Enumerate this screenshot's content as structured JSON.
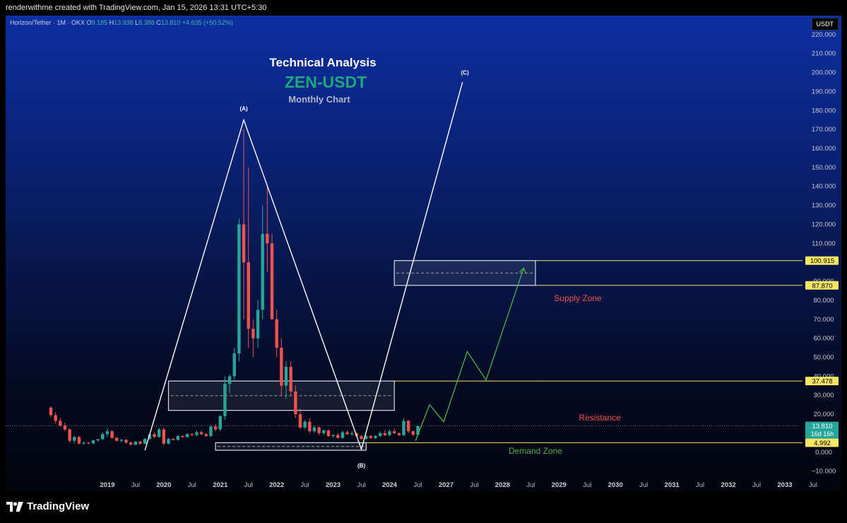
{
  "header": {
    "attribution": "renderwithme created with TradingView.com, Jan 15, 2026 13:31 UTC+5:30"
  },
  "legend": {
    "symbol": "Horizon/Tether · 1M · OKX",
    "open_label": "O",
    "open": "9.185",
    "high_label": "H",
    "high": "13.938",
    "low_label": "L",
    "low": "8.388",
    "close_label": "C",
    "close": "13.810",
    "change": "+4.635 (+50.52%)"
  },
  "currency_button": "USDT",
  "titles": {
    "title": "Technical Analysis",
    "pair": "ZEN-USDT",
    "subtitle": "Monthly Chart",
    "title_color": "#ffffff",
    "pair_color": "#1fa77c",
    "subtitle_color": "#aeb6c8"
  },
  "wave_labels": [
    "(A)",
    "(B)",
    "(C)"
  ],
  "zone_labels": {
    "supply": "Supply Zone",
    "resistance": "Resistance",
    "demand": "Demand Zone"
  },
  "colors": {
    "up": "#26a69a",
    "down": "#ef5350",
    "projection": "#4caf50",
    "level_line": "#f5e663",
    "supply_label": "#ef5350",
    "resistance_label": "#ef5350",
    "demand_label": "#4caf50",
    "price_badge": "#26a69a"
  },
  "chart_data": {
    "type": "candlestick",
    "symbol": "ZEN-USDT",
    "timeframe": "1M",
    "y_axis": {
      "ticks": [
        -10,
        0,
        10,
        20,
        30,
        40,
        50,
        60,
        70,
        80,
        90,
        100,
        110,
        120,
        130,
        140,
        150,
        160,
        170,
        180,
        190,
        200,
        210,
        220
      ],
      "tick_labels": [
        "−10.000",
        "0.000",
        "10.000",
        "20.000",
        "30.000",
        "40.000",
        "50.000",
        "60.000",
        "70.000",
        "80.000",
        "90.000",
        "100.000",
        "110.000",
        "120.000",
        "130.000",
        "140.000",
        "150.000",
        "160.000",
        "170.000",
        "180.000",
        "190.000",
        "200.000",
        "210.000",
        "220.000"
      ],
      "range": [
        -12,
        230
      ]
    },
    "x_axis": {
      "labels": [
        {
          "label": "2019",
          "m": 12,
          "bold": true
        },
        {
          "label": "Jul",
          "m": 18,
          "bold": false
        },
        {
          "label": "2020",
          "m": 24,
          "bold": true
        },
        {
          "label": "Jul",
          "m": 30,
          "bold": false
        },
        {
          "label": "2021",
          "m": 36,
          "bold": true
        },
        {
          "label": "Jul",
          "m": 42,
          "bold": false
        },
        {
          "label": "2022",
          "m": 48,
          "bold": true
        },
        {
          "label": "Jul",
          "m": 54,
          "bold": false
        },
        {
          "label": "2023",
          "m": 60,
          "bold": true
        },
        {
          "label": "Jul",
          "m": 66,
          "bold": false
        },
        {
          "label": "2024",
          "m": 72,
          "bold": true
        },
        {
          "label": "Jul",
          "m": 78,
          "bold": false
        },
        {
          "label": "2027",
          "m": 84,
          "bold": true
        },
        {
          "label": "Jul",
          "m": 90,
          "bold": false
        },
        {
          "label": "2028",
          "m": 96,
          "bold": true
        },
        {
          "label": "Jul",
          "m": 102,
          "bold": false
        },
        {
          "label": "2029",
          "m": 108,
          "bold": true
        },
        {
          "label": "Jul",
          "m": 114,
          "bold": false
        },
        {
          "label": "2030",
          "m": 120,
          "bold": true
        },
        {
          "label": "Jul",
          "m": 126,
          "bold": false
        },
        {
          "label": "2031",
          "m": 132,
          "bold": true
        },
        {
          "label": "Jul",
          "m": 138,
          "bold": false
        },
        {
          "label": "2032",
          "m": 144,
          "bold": true
        },
        {
          "label": "Jul",
          "m": 150,
          "bold": false
        },
        {
          "label": "2033",
          "m": 156,
          "bold": true
        },
        {
          "label": "Jul",
          "m": 162,
          "bold": false
        }
      ],
      "range": [
        0,
        168
      ]
    },
    "candles": [
      [
        23.5,
        24.0,
        18.5,
        19.5
      ],
      [
        19.5,
        21.0,
        15.0,
        16.5
      ],
      [
        16.5,
        18.0,
        13.5,
        14.0
      ],
      [
        14.0,
        15.5,
        11.0,
        12.0
      ],
      [
        12.0,
        12.5,
        5.0,
        6.0
      ],
      [
        6.0,
        8.5,
        4.5,
        8.0
      ],
      [
        8.0,
        8.5,
        4.0,
        4.5
      ],
      [
        4.5,
        5.5,
        4.0,
        5.0
      ],
      [
        5.0,
        5.5,
        4.2,
        4.6
      ],
      [
        4.6,
        6.5,
        4.0,
        6.2
      ],
      [
        6.2,
        7.0,
        5.5,
        6.8
      ],
      [
        6.8,
        10.5,
        6.5,
        9.5
      ],
      [
        9.5,
        12.5,
        8.0,
        11.0
      ],
      [
        11.0,
        11.5,
        7.0,
        7.5
      ],
      [
        7.5,
        8.0,
        5.5,
        6.0
      ],
      [
        6.0,
        7.0,
        5.0,
        6.5
      ],
      [
        6.5,
        7.0,
        4.5,
        5.0
      ],
      [
        5.0,
        5.5,
        3.5,
        4.0
      ],
      [
        4.0,
        6.0,
        3.5,
        5.5
      ],
      [
        5.5,
        6.0,
        4.0,
        4.5
      ],
      [
        4.5,
        7.5,
        4.0,
        7.0
      ],
      [
        7.0,
        10.0,
        6.5,
        9.5
      ],
      [
        9.5,
        10.5,
        7.5,
        8.0
      ],
      [
        8.0,
        13.0,
        7.5,
        12.0
      ],
      [
        12.0,
        13.0,
        3.5,
        4.5
      ],
      [
        4.5,
        7.5,
        4.0,
        7.0
      ],
      [
        7.0,
        7.5,
        6.0,
        6.5
      ],
      [
        6.5,
        9.0,
        6.0,
        8.5
      ],
      [
        8.5,
        9.0,
        7.5,
        8.0
      ],
      [
        8.0,
        10.0,
        7.5,
        9.5
      ],
      [
        9.5,
        10.0,
        8.5,
        9.0
      ],
      [
        9.0,
        11.5,
        8.5,
        10.5
      ],
      [
        10.5,
        11.5,
        9.0,
        9.5
      ],
      [
        9.5,
        10.0,
        8.0,
        8.5
      ],
      [
        8.5,
        14.0,
        8.0,
        13.5
      ],
      [
        13.5,
        15.0,
        11.0,
        12.0
      ],
      [
        12.0,
        19.5,
        11.0,
        19.0
      ],
      [
        19.0,
        40.0,
        17.0,
        36.0
      ],
      [
        36.0,
        41.0,
        31.0,
        40.0
      ],
      [
        40.0,
        55.0,
        38.0,
        52.0
      ],
      [
        52.0,
        123.0,
        48.0,
        120.0
      ],
      [
        120.0,
        170.0,
        70.0,
        100.0
      ],
      [
        100.0,
        150.0,
        55.0,
        65.0
      ],
      [
        65.0,
        70.0,
        50.0,
        60.0
      ],
      [
        60.0,
        80.0,
        55.0,
        75.0
      ],
      [
        75.0,
        130.0,
        70.0,
        115.0
      ],
      [
        115.0,
        140.0,
        95.0,
        110.0
      ],
      [
        110.0,
        115.0,
        80.0,
        70.0
      ],
      [
        70.0,
        75.0,
        50.0,
        55.0
      ],
      [
        55.0,
        60.0,
        30.0,
        35.0
      ],
      [
        35.0,
        48.0,
        28.0,
        45.0
      ],
      [
        45.0,
        48.0,
        30.0,
        32.0
      ],
      [
        32.0,
        35.0,
        18.0,
        20.0
      ],
      [
        20.0,
        23.0,
        12.0,
        13.0
      ],
      [
        13.0,
        17.0,
        12.0,
        16.0
      ],
      [
        16.0,
        18.0,
        10.0,
        11.0
      ],
      [
        11.0,
        14.0,
        10.0,
        13.0
      ],
      [
        13.0,
        13.5,
        9.0,
        10.0
      ],
      [
        10.0,
        12.0,
        9.0,
        11.5
      ],
      [
        11.5,
        12.0,
        8.0,
        8.5
      ],
      [
        8.5,
        9.5,
        7.5,
        9.0
      ],
      [
        9.0,
        10.0,
        7.0,
        7.5
      ],
      [
        7.5,
        11.5,
        7.0,
        10.5
      ],
      [
        10.5,
        11.5,
        9.0,
        9.5
      ],
      [
        9.5,
        11.0,
        8.5,
        10.0
      ],
      [
        10.0,
        10.5,
        8.0,
        8.5
      ],
      [
        8.5,
        9.0,
        6.5,
        7.0
      ],
      [
        7.0,
        9.0,
        6.5,
        8.5
      ],
      [
        8.5,
        9.0,
        7.0,
        7.5
      ],
      [
        7.5,
        9.0,
        7.0,
        8.5
      ],
      [
        8.5,
        11.0,
        8.0,
        10.0
      ],
      [
        10.0,
        11.5,
        8.5,
        9.0
      ],
      [
        9.0,
        12.0,
        8.5,
        11.0
      ],
      [
        11.0,
        12.5,
        9.5,
        10.0
      ],
      [
        10.0,
        10.5,
        8.5,
        9.0
      ],
      [
        9.0,
        18.0,
        8.5,
        16.5
      ],
      [
        16.5,
        17.0,
        10.0,
        11.0
      ],
      [
        11.0,
        11.5,
        8.5,
        9.2
      ],
      [
        9.185,
        13.938,
        8.388,
        13.81
      ]
    ],
    "wave_path": [
      [
        8,
        180,
        150
      ],
      [
        41,
        175,
        0
      ],
      [
        44.5,
        1,
        0
      ],
      [
        55,
        195,
        0
      ]
    ],
    "projection_path": [
      [
        70,
        6
      ],
      [
        72,
        25
      ],
      [
        75,
        16
      ],
      [
        79,
        53
      ],
      [
        82,
        38
      ],
      [
        88,
        97
      ]
    ],
    "zones": [
      {
        "name": "Supply Zone",
        "x0": 73,
        "x1": 103,
        "y0": 87.87,
        "y1": 100.915
      },
      {
        "name": "Resistance",
        "x0": 25,
        "x1": 73,
        "y0": 22.0,
        "y1": 37.478
      },
      {
        "name": "Demand Zone",
        "x0": 35,
        "x1": 67,
        "y0": 4.992,
        "y1": 1.0
      }
    ],
    "levels": [
      {
        "value": 100.915,
        "label": "100.915",
        "from": 103
      },
      {
        "value": 87.87,
        "label": "87.870",
        "from": 103
      },
      {
        "value": 37.478,
        "label": "37.478",
        "from": 73
      },
      {
        "value": 4.992,
        "label": "4.992",
        "from": 67
      }
    ],
    "last_price": {
      "value": 13.81,
      "label": "13.810",
      "countdown": "16d 16h"
    },
    "y_range": [
      -12,
      230
    ]
  },
  "footer": {
    "brand": "TradingView"
  }
}
